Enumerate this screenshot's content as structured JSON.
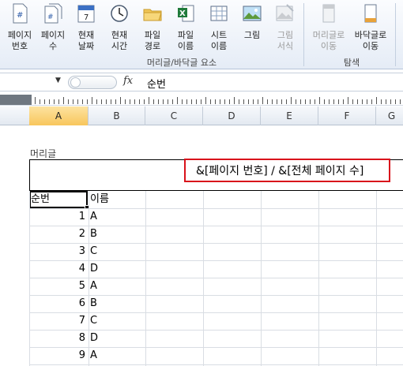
{
  "ribbon": {
    "buttons": [
      {
        "name": "page-number-button",
        "label": "페이지\n번호",
        "icon": "page-number-icon",
        "disabled": false
      },
      {
        "name": "page-count-button",
        "label": "페이지\n수",
        "icon": "page-count-icon",
        "disabled": false
      },
      {
        "name": "current-date-button",
        "label": "현재\n날짜",
        "icon": "calendar-icon",
        "disabled": false
      },
      {
        "name": "current-time-button",
        "label": "현재\n시간",
        "icon": "clock-icon",
        "disabled": false
      },
      {
        "name": "file-path-button",
        "label": "파일\n경로",
        "icon": "folder-icon",
        "disabled": false
      },
      {
        "name": "file-name-button",
        "label": "파일\n이름",
        "icon": "excel-file-icon",
        "disabled": false
      },
      {
        "name": "sheet-name-button",
        "label": "시트\n이름",
        "icon": "sheet-icon",
        "disabled": false
      },
      {
        "name": "picture-button",
        "label": "그림",
        "icon": "picture-icon",
        "disabled": false
      },
      {
        "name": "format-picture-button",
        "label": "그림\n서식",
        "icon": "format-picture-icon",
        "disabled": true
      },
      {
        "name": "go-to-header-button",
        "label": "머리글로\n이동",
        "icon": "go-to-header-icon",
        "disabled": true
      },
      {
        "name": "go-to-footer-button",
        "label": "바닥글로\n이동",
        "icon": "go-to-footer-icon",
        "disabled": false
      }
    ],
    "groups": {
      "elements": "머리글/바닥글 요소",
      "navigation": "탐색"
    }
  },
  "formula_bar": {
    "name_box": "",
    "fx": "fx",
    "value": "순번"
  },
  "columns": [
    "A",
    "B",
    "C",
    "D",
    "E",
    "F",
    "G"
  ],
  "selected_column": "A",
  "page": {
    "header_caption": "머리글",
    "header_field": "&[페이지 번호] / &[전체 페이지 수]"
  },
  "table": {
    "headers": [
      "순번",
      "이름"
    ],
    "rows": [
      [
        "1",
        "A"
      ],
      [
        "2",
        "B"
      ],
      [
        "3",
        "C"
      ],
      [
        "4",
        "D"
      ],
      [
        "5",
        "A"
      ],
      [
        "6",
        "B"
      ],
      [
        "7",
        "C"
      ],
      [
        "8",
        "D"
      ],
      [
        "9",
        "A"
      ]
    ]
  },
  "colors": {
    "accent_red": "#d9121b",
    "selected_header": "#f8c65c"
  }
}
